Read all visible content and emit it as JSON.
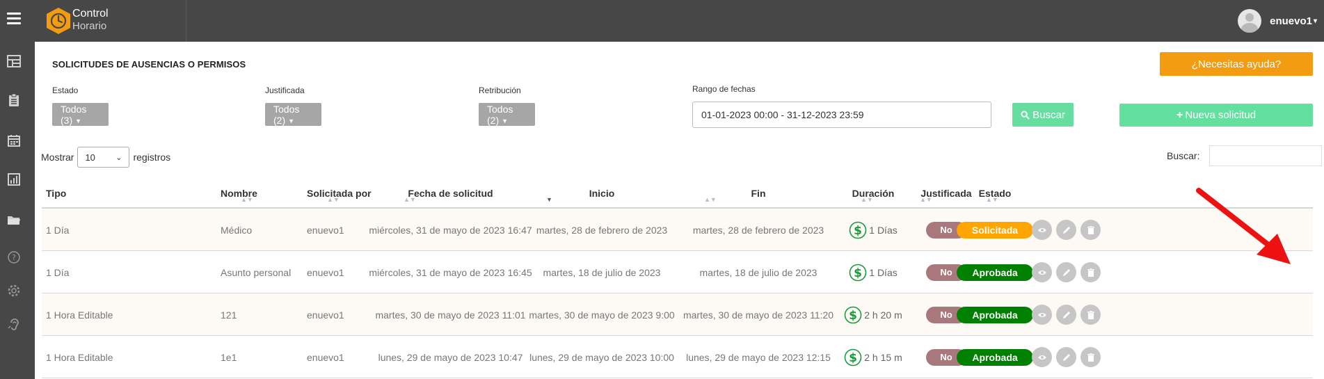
{
  "header": {
    "brand_line1": "Control",
    "brand_line2": "Horario",
    "username": "enuevo1",
    "brand_color": "#f39c12"
  },
  "sidebar": {
    "icons": [
      "dashboard-icon",
      "clipboard-icon",
      "calendar-icon",
      "report-icon",
      "folder-icon",
      "help-icon",
      "settings-icon",
      "hearing-icon"
    ]
  },
  "page": {
    "title": "SOLICITUDES DE AUSENCIAS O PERMISOS",
    "help_label": "¿Necesitas ayuda?"
  },
  "filters": {
    "estado": {
      "label": "Estado",
      "value": "Todos (3)"
    },
    "justificada": {
      "label": "Justificada",
      "value": "Todos (2)"
    },
    "retribucion": {
      "label": "Retribución",
      "value": "Todos (2)"
    },
    "rango": {
      "label": "Rango de fechas",
      "value": "01-01-2023 00:00 - 31-12-2023 23:59"
    },
    "search_label": "Buscar",
    "new_label": "Nueva solicitud"
  },
  "table_controls": {
    "show_label": "Mostrar",
    "show_value": "10",
    "records_label": "registros",
    "search_label": "Buscar:"
  },
  "table": {
    "headers": {
      "tipo": "Tipo",
      "nombre": "Nombre",
      "solicitada": "Solicitada por",
      "fecha": "Fecha de solicitud",
      "inicio": "Inicio",
      "fin": "Fin",
      "duracion": "Duración",
      "justificada": "Justificada",
      "estado": "Estado"
    },
    "rows": [
      {
        "tipo": "1 Día",
        "nombre": "Médico",
        "solicitada": "enuevo1",
        "fecha": "miércoles, 31 de mayo de 2023 16:47",
        "inicio": "martes, 28 de febrero de 2023",
        "fin": "martes, 28 de febrero de 2023",
        "duracion": "1 Días",
        "justificada": "No",
        "estado": "Solicitada",
        "estado_color": "#ffa500"
      },
      {
        "tipo": "1 Día",
        "nombre": "Asunto personal",
        "solicitada": "enuevo1",
        "fecha": "miércoles, 31 de mayo de 2023 16:45",
        "inicio": "martes, 18 de julio de 2023",
        "fin": "martes, 18 de julio de 2023",
        "duracion": "1 Días",
        "justificada": "No",
        "estado": "Aprobada",
        "estado_color": "#008000"
      },
      {
        "tipo": "1 Hora Editable",
        "nombre": "121",
        "solicitada": "enuevo1",
        "fecha": "martes, 30 de mayo de 2023 11:01",
        "inicio": "martes, 30 de mayo de 2023 9:00",
        "fin": "martes, 30 de mayo de 2023 11:20",
        "duracion": "2 h 20 m",
        "justificada": "No",
        "estado": "Aprobada",
        "estado_color": "#008000"
      },
      {
        "tipo": "1 Hora Editable",
        "nombre": "1e1",
        "solicitada": "enuevo1",
        "fecha": "lunes, 29 de mayo de 2023 10:47",
        "inicio": "lunes, 29 de mayo de 2023 10:00",
        "fin": "lunes, 29 de mayo de 2023 12:15",
        "duracion": "2 h 15 m",
        "justificada": "No",
        "estado": "Aprobada",
        "estado_color": "#008000"
      }
    ]
  },
  "annotation": {
    "arrow_color": "#ee1111"
  }
}
